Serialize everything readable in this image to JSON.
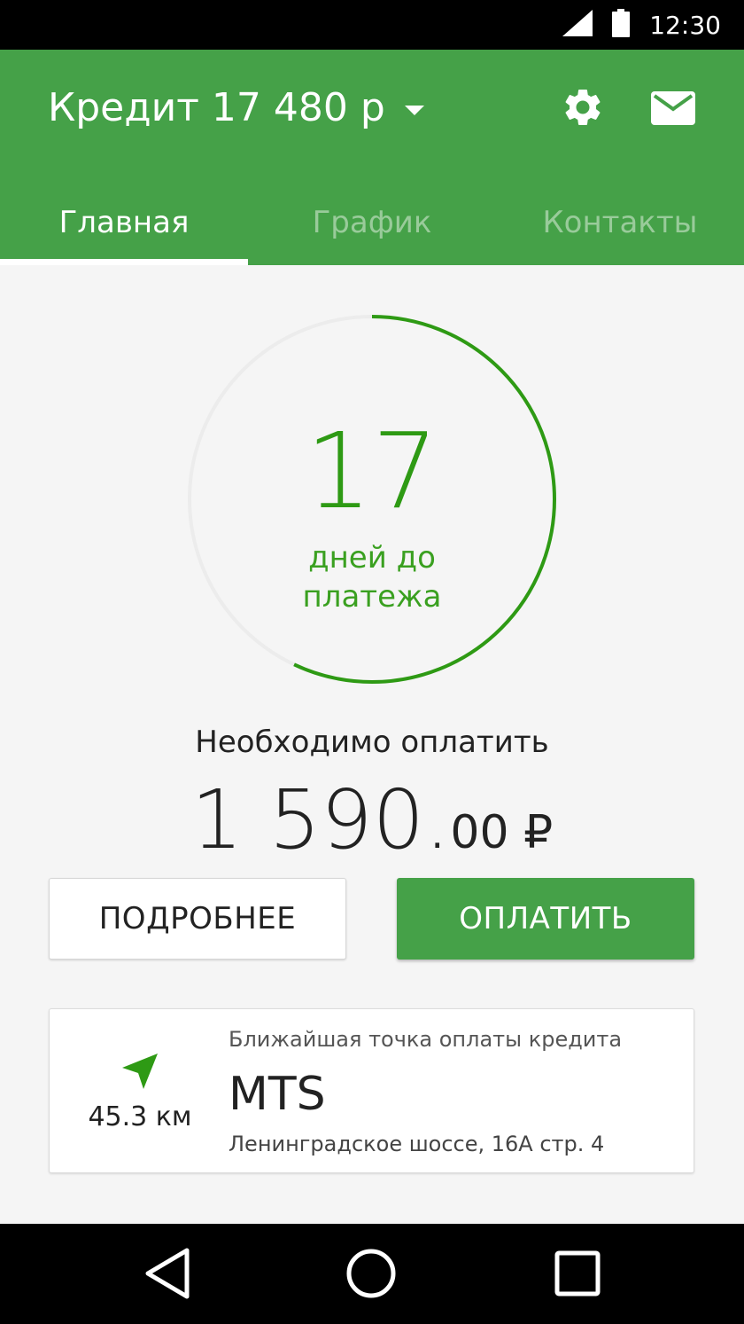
{
  "status_bar": {
    "time": "12:30",
    "signal_icon": "signal-icon",
    "battery_icon": "battery-icon"
  },
  "header": {
    "title": "Кредит 17 480 р",
    "settings_icon": "gear-icon",
    "mail_icon": "mail-icon",
    "tabs": [
      {
        "label": "Главная",
        "active": true
      },
      {
        "label": "График",
        "active": false
      },
      {
        "label": "Контакты",
        "active": false
      }
    ]
  },
  "countdown": {
    "days": "17",
    "label_line1": "дней до",
    "label_line2": "платежа",
    "progress_fraction": 0.57
  },
  "payment": {
    "label": "Необходимо оплатить",
    "amount_main": "1 590.",
    "amount_fraction": "00 ₽"
  },
  "buttons": {
    "details": "ПОДРОБНЕЕ",
    "pay": "ОПЛАТИТЬ"
  },
  "nearest_point": {
    "distance": "45.3 км",
    "caption": "Ближайшая точка оплаты кредита",
    "name": "MTS",
    "address": "Ленинградское шоссе, 16А стр. 4"
  },
  "colors": {
    "primary": "#45a148",
    "ring": "#2e9a14",
    "ring_track": "#ececec"
  }
}
